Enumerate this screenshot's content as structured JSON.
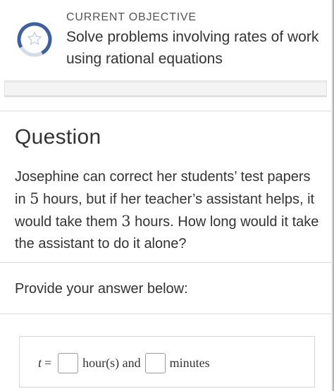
{
  "objective": {
    "label": "CURRENT OBJECTIVE",
    "text": "Solve problems involving rates of work using rational equations",
    "icon": "star-progress-icon"
  },
  "question": {
    "title": "Question",
    "body_parts": [
      "Josephine can correct her students’ test papers in ",
      "5",
      " hours, but if her teacher’s assistant helps, it would take them ",
      "3",
      " hours. How long would it take the assistant to do it alone?"
    ]
  },
  "answer": {
    "prompt": "Provide your answer below:",
    "variable": "t",
    "equals": "=",
    "unit1": "hour(s) and",
    "unit2": "minutes"
  },
  "colors": {
    "accent_blue": "#3d5fa3",
    "progress_gray": "#cfd6e4",
    "text": "#333333"
  }
}
